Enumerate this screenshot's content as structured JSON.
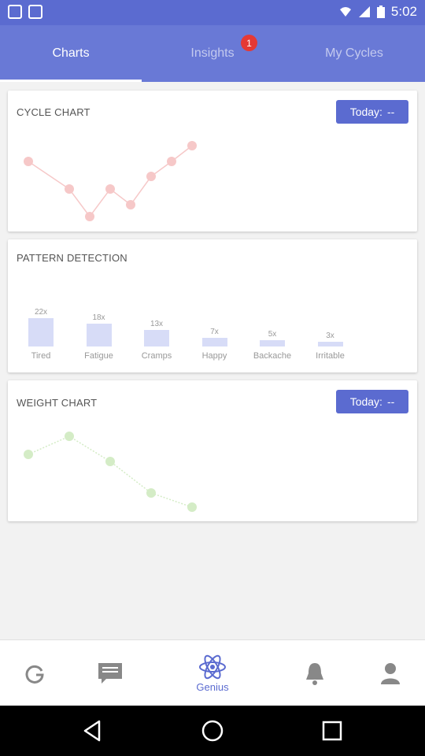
{
  "status_bar": {
    "time": "5:02"
  },
  "tabs": [
    {
      "label": "Charts"
    },
    {
      "label": "Insights",
      "badge": "1"
    },
    {
      "label": "My Cycles"
    }
  ],
  "cycle_chart": {
    "title": "CYCLE CHART",
    "today_label": "Today:",
    "today_value": "--",
    "point_color": "#f6c8c8"
  },
  "pattern_detection": {
    "title": "PATTERN DETECTION",
    "bars": [
      {
        "label": "Tired",
        "count": "22x",
        "value": 22
      },
      {
        "label": "Fatigue",
        "count": "18x",
        "value": 18
      },
      {
        "label": "Cramps",
        "count": "13x",
        "value": 13
      },
      {
        "label": "Happy",
        "count": "7x",
        "value": 7
      },
      {
        "label": "Backache",
        "count": "5x",
        "value": 5
      },
      {
        "label": "Irritable",
        "count": "3x",
        "value": 3
      }
    ]
  },
  "weight_chart": {
    "title": "WEIGHT CHART",
    "today_label": "Today:",
    "today_value": "--",
    "point_color": "#d4ecc6"
  },
  "bottom_nav": {
    "genius_label": "Genius"
  },
  "colors": {
    "primary": "#6979d6",
    "accent": "#5b6bd0",
    "badge": "#e53935"
  }
}
